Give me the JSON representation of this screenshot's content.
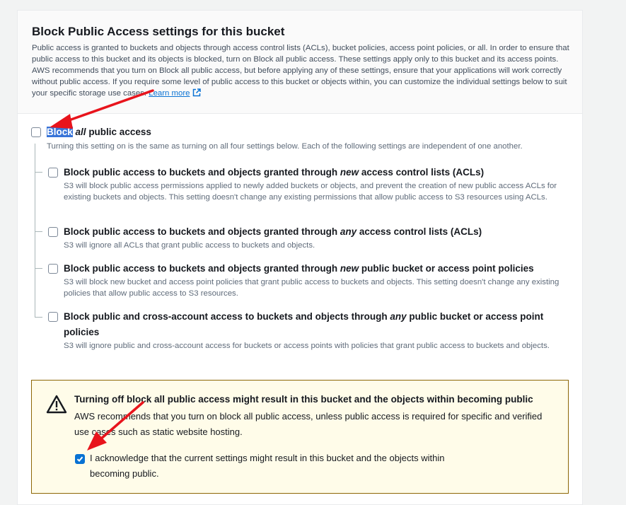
{
  "header": {
    "title": "Block Public Access settings for this bucket",
    "description": "Public access is granted to buckets and objects through access control lists (ACLs), bucket policies, access point policies, or all. In order to ensure that public access to this bucket and its objects is blocked, turn on Block all public access. These settings apply only to this bucket and its access points. AWS recommends that you turn on Block all public access, but before applying any of these settings, ensure that your applications will work correctly without public access. If you require some level of public access to this bucket or objects within, you can customize the individual settings below to suit your specific storage use cases.",
    "learn_more": "Learn more",
    "external_icon": "external-link-icon"
  },
  "block_all": {
    "label_highlight": "Block",
    "label_italic": "all",
    "label_rest": "public access",
    "description": "Turning this setting on is the same as turning on all four settings below. Each of the following settings are independent of one another.",
    "checked": false
  },
  "options": [
    {
      "pre": "Block public access to buckets and objects granted through",
      "em": "new",
      "post": "access control lists (ACLs)",
      "description": "S3 will block public access permissions applied to newly added buckets or objects, and prevent the creation of new public access ACLs for existing buckets and objects. This setting doesn't change any existing permissions that allow public access to S3 resources using ACLs.",
      "checked": false
    },
    {
      "pre": "Block public access to buckets and objects granted through",
      "em": "any",
      "post": "access control lists (ACLs)",
      "description": "S3 will ignore all ACLs that grant public access to buckets and objects.",
      "checked": false
    },
    {
      "pre": "Block public access to buckets and objects granted through",
      "em": "new",
      "post": "public bucket or access point policies",
      "description": "S3 will block new bucket and access point policies that grant public access to buckets and objects. This setting doesn't change any existing policies that allow public access to S3 resources.",
      "checked": false
    },
    {
      "pre": "Block public and cross-account access to buckets and objects through",
      "em": "any",
      "post": "public bucket or access point policies",
      "description": "S3 will ignore public and cross-account access for buckets or access points with policies that grant public access to buckets and objects.",
      "checked": false
    }
  ],
  "warning": {
    "icon": "warning-triangle-icon",
    "title": "Turning off block all public access might result in this bucket and the objects within becoming public",
    "text": "AWS recommends that you turn on block all public access, unless public access is required for specific and verified use cases such as static website hosting.",
    "acknowledge": "I acknowledge that the current settings might result in this bucket and the objects within becoming public.",
    "acknowledge_checked": true
  },
  "colors": {
    "link": "#0972d3",
    "checkbox_checked": "#0972d3",
    "warning_bg": "#fffce9",
    "warning_border": "#8d6605",
    "annotation_arrow": "#e8141c",
    "highlight": "#3874d8"
  }
}
